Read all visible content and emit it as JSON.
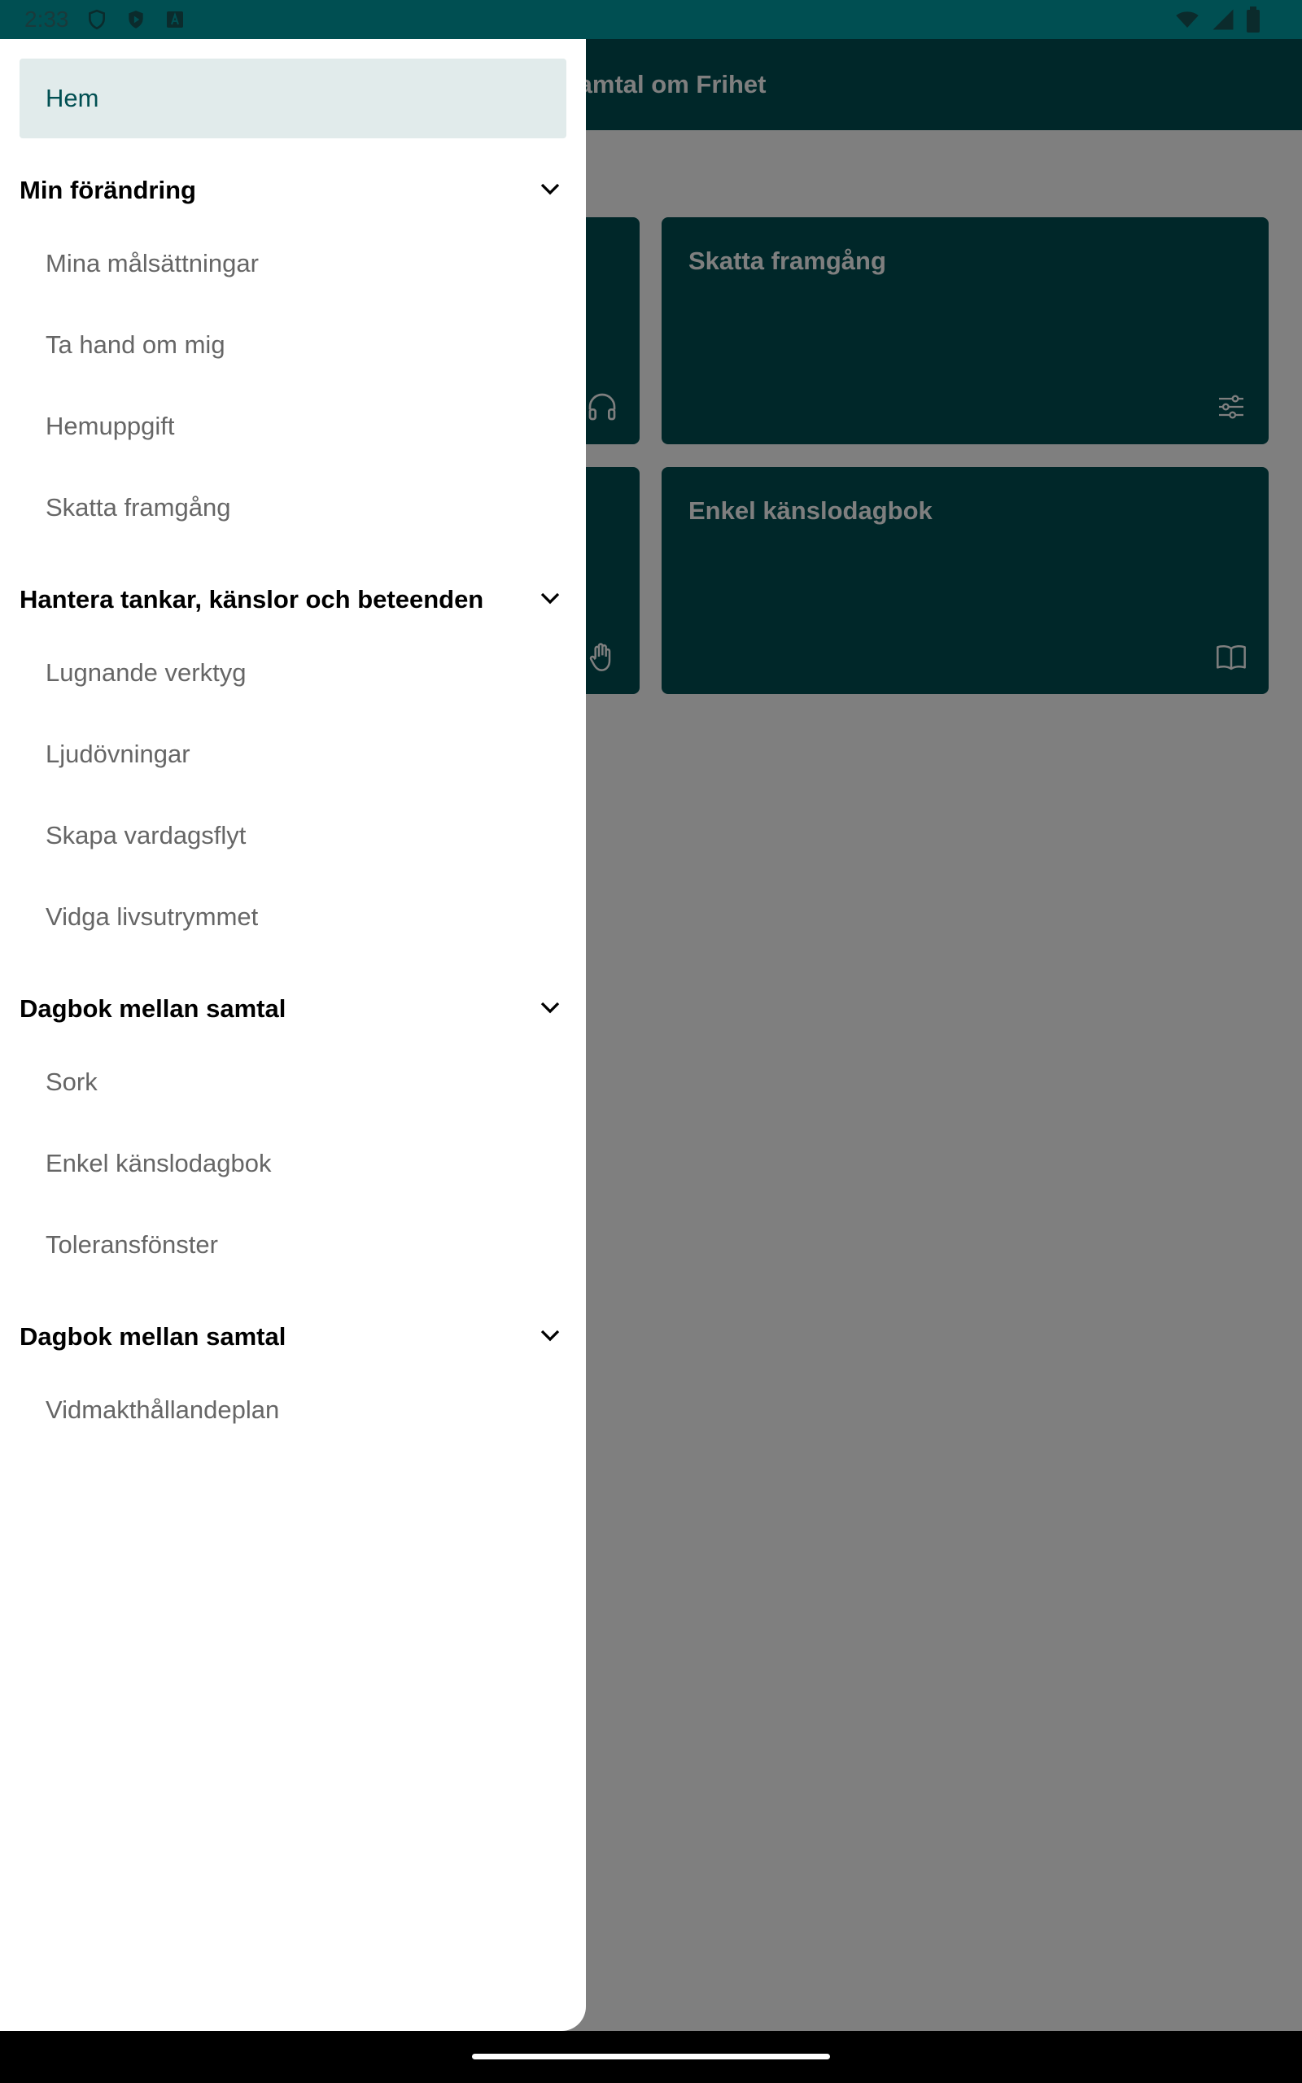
{
  "status_bar": {
    "time": "2:33"
  },
  "app_bar": {
    "title": "Samtal om Frihet"
  },
  "cards": [
    {
      "title": "Skatta framgång",
      "icon": "sliders-icon"
    },
    {
      "title": "Enkel känslodagbok",
      "icon": "book-icon"
    }
  ],
  "drawer": {
    "home_label": "Hem",
    "sections": [
      {
        "title": "Min förändring",
        "items": [
          "Mina målsättningar",
          "Ta hand om mig",
          "Hemuppgift",
          "Skatta framgång"
        ]
      },
      {
        "title": "Hantera tankar, känslor och beteenden",
        "items": [
          "Lugnande verktyg",
          "Ljudövningar",
          "Skapa vardagsflyt",
          "Vidga livsutrymmet"
        ]
      },
      {
        "title": "Dagbok mellan samtal",
        "items": [
          "Sork",
          "Enkel känslodagbok",
          "Toleransfönster"
        ]
      },
      {
        "title": "Dagbok mellan samtal",
        "items": [
          "Vidmakthållandeplan"
        ]
      }
    ]
  },
  "colors": {
    "primary": "#004f52",
    "home_selected_bg": "#e1ebeb",
    "menu_text": "#666666",
    "scrim": "rgba(0,0,0,0.5)"
  }
}
